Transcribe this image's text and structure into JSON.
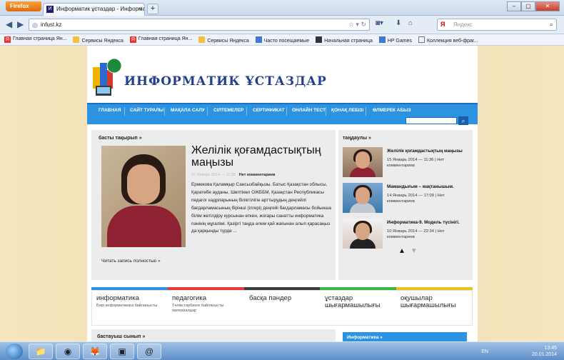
{
  "browser": {
    "menu_button": "Firefox",
    "tab_title": "Информатик ұстаздар - Информатикт...",
    "tab_favicon": "И",
    "new_tab": "+",
    "url": "infust.kz",
    "search_engine": "Я",
    "search_placeholder": "Яндекс",
    "bookmarks": [
      "Главная страница Ян...",
      "Сервисы Яндекса",
      "Главная страница Ян...",
      "Сервисы Яндекса",
      "Часто посещаемые",
      "Начальная страница",
      "HP Games",
      "Коллекция веб-фраг..."
    ]
  },
  "site": {
    "title": "ИНФОРМАТИК ҰСТАЗДАР",
    "menu": [
      "ГЛАВНАЯ",
      "САЙТ ТУРАЛЫ",
      "МАҚАЛА САЛУ",
      "СІЛТЕМЕЛЕР",
      "СЕРТИФИКАТ",
      "ОНЛАЙН ТЕСТ",
      "ҚОНАҚ ЛЕБІЗІ",
      "ӨЛМЕРЕК АБЫЗ"
    ],
    "main": {
      "section": "басты тақырып »",
      "article_title": "Желілік қоғамдастықтың маңызы",
      "meta_date": "15 Январь 2014 — 11:36",
      "meta_comments": "Нет комментариев",
      "text": "Ермекова Қаламқыр Сансызбайқызы. Батыс Қазақстан облысы, Қаратөбе ауданы, Шөптікөл ОЖББМ, Қазақстан Республикасы педагог кадрларының біліктілігін арттырудың деңгейлі бағдарламасының бірінші (ілгері) деңгейі бағдарламасы бойынша білім жетілдіру курсынан өткен, жоғары санатты информатика пәнінің мұғалімі. Қазіргі таңда әлем қай жағынан алып қарасаңыз да қарқынды түрде ...",
      "read_more": "Читать запись полностью »"
    },
    "sidebar": {
      "section": "таңдаулы »",
      "items": [
        {
          "title": "Желілік қоғамдастықтың маңызы",
          "date": "15 Январь 2014 — 11:36 | Нет комментариев"
        },
        {
          "title": "Мамандығым – мақтанышым.",
          "date": "14 Январь 2014 — 17:09 | Нет комментариев"
        },
        {
          "title": "Информатика-9. Модель түсінігі.",
          "date": "10 Январь 2014 — 22:34 | Нет комментариев"
        }
      ],
      "up_arrow": "▲",
      "down_arrow": "▼"
    },
    "categories": [
      {
        "name": "информатика",
        "sub": "Бәрі информатикага байланысты",
        "color": "#2b93e2"
      },
      {
        "name": "педагогика",
        "sub": "Тәлім-тәрбиеге байланысты материалдар",
        "color": "#e23b3b"
      },
      {
        "name": "басқа пәндер",
        "sub": "",
        "color": "#3a3a3a"
      },
      {
        "name": "ұстаздар шығармашылығы",
        "sub": "",
        "color": "#3bb54a"
      },
      {
        "name": "оқушылар шығармашылығы",
        "sub": "",
        "color": "#e8c21e"
      }
    ],
    "bottom_left_section": "бастауыш сынып »",
    "bottom_right_section": "Информатика »"
  },
  "taskbar": {
    "lang": "EN",
    "time": "13:45",
    "date": "20.01.2014"
  }
}
